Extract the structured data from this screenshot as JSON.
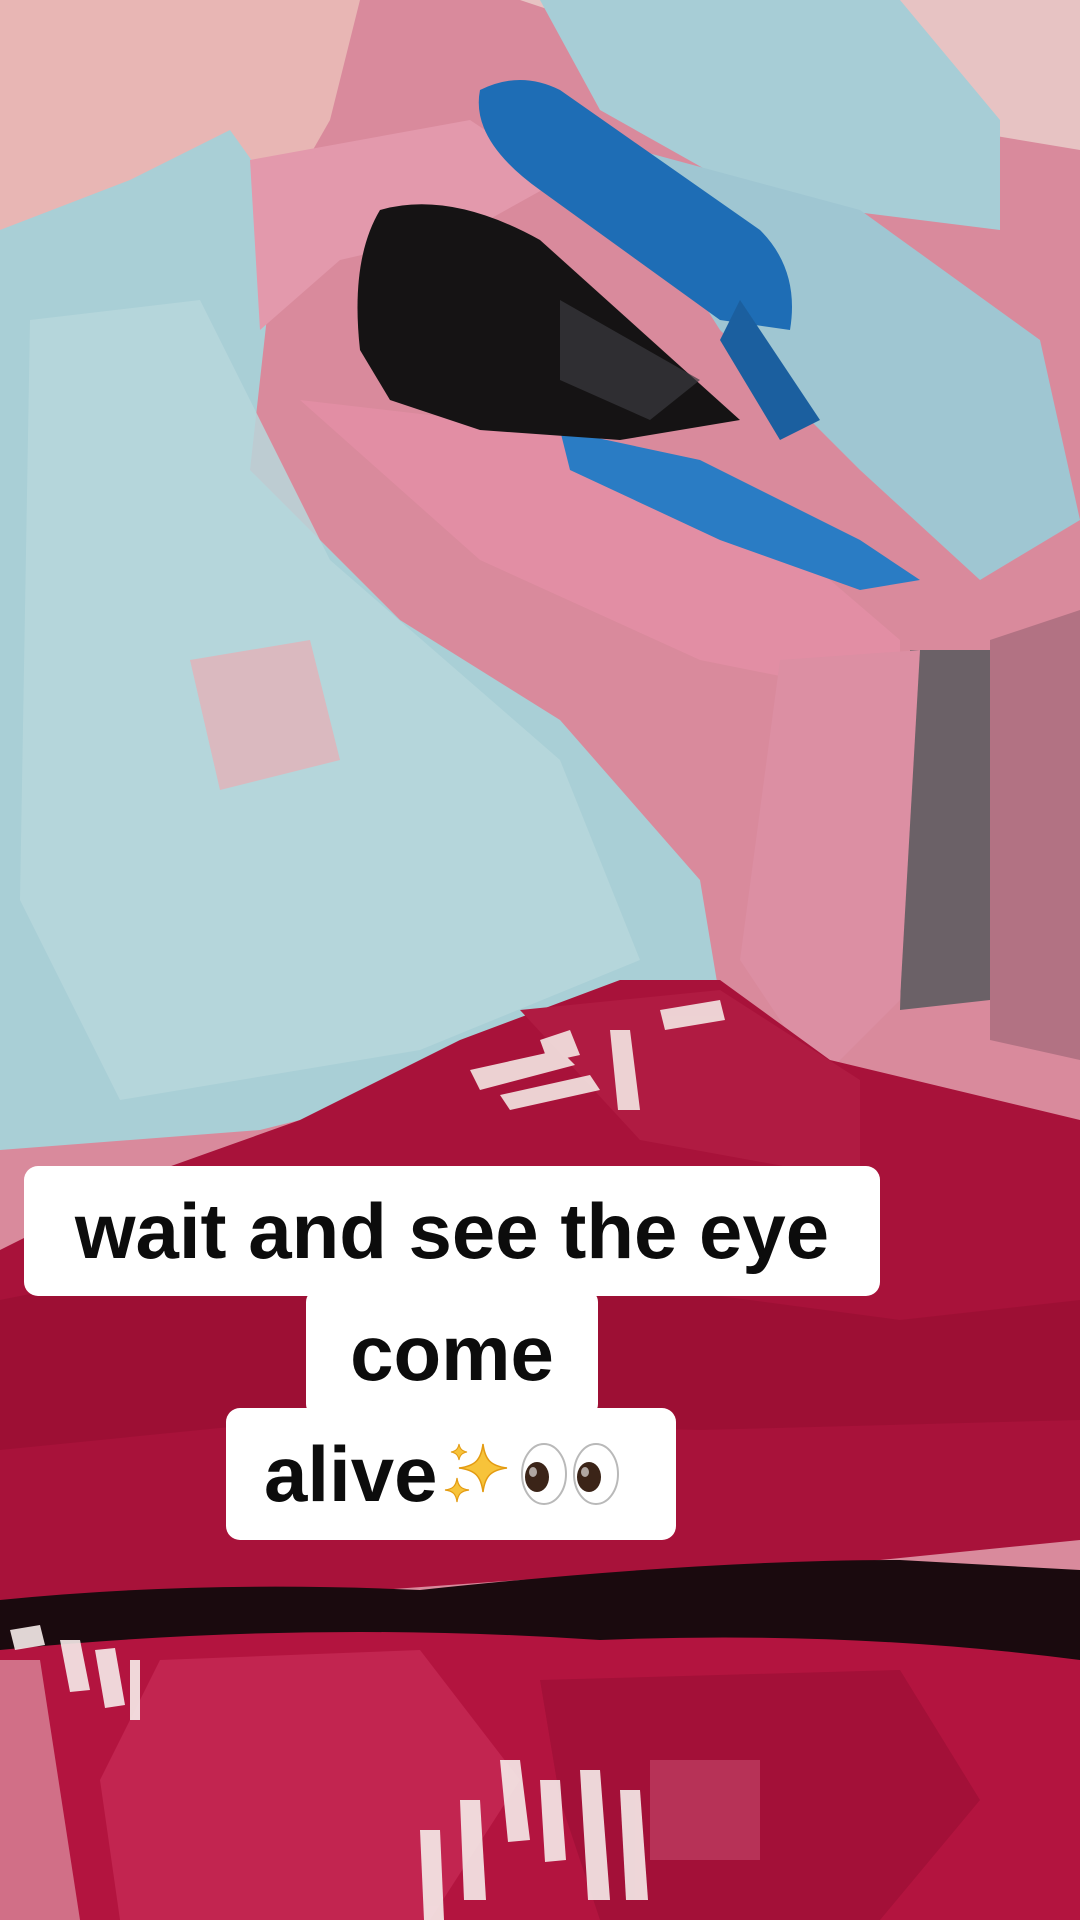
{
  "caption": {
    "line1": "wait and see the eye",
    "line2": "come",
    "line3": "alive"
  },
  "icons": {
    "sparkles": "sparkles-icon",
    "eyes": "eyes-icon"
  },
  "colors": {
    "caption_bg": "#ffffff",
    "caption_text": "#0c0c0c",
    "lip_red": "#a8123a",
    "skin_pink": "#d98a9c",
    "pale_blue": "#a9cfd6",
    "stroke_blue": "#1f6fb8"
  }
}
